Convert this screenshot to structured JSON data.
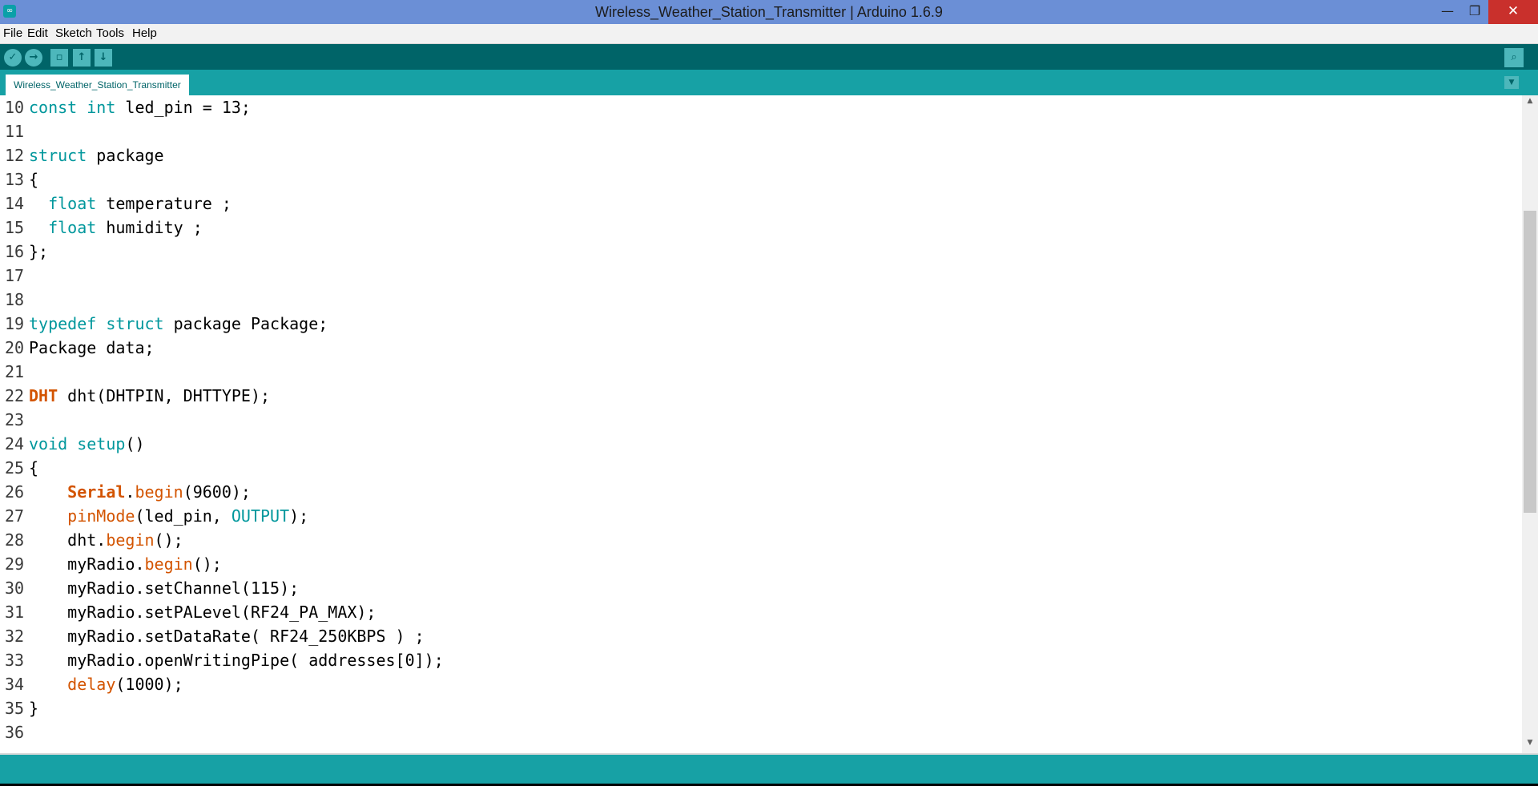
{
  "window": {
    "title": "Wireless_Weather_Station_Transmitter | Arduino 1.6.9",
    "app_icon": "∞",
    "minimize": "—",
    "maximize": "❐",
    "close": "✕"
  },
  "menubar": {
    "items": [
      "File",
      "Edit",
      "Sketch",
      "Tools",
      "Help"
    ]
  },
  "toolbar": {
    "verify_icon": "✓",
    "upload_icon": "→",
    "new_icon": "▫",
    "open_icon": "↑",
    "save_icon": "↓",
    "serial_monitor_icon": "⌕"
  },
  "tabs": {
    "active": "Wireless_Weather_Station_Transmitter",
    "menu_icon": "▼"
  },
  "editor": {
    "lines": [
      {
        "n": "10",
        "tokens": [
          {
            "c": "kw",
            "t": "const"
          },
          {
            "c": "txt",
            "t": " "
          },
          {
            "c": "kw",
            "t": "int"
          },
          {
            "c": "txt",
            "t": " led_pin = 13;"
          }
        ]
      },
      {
        "n": "11",
        "tokens": []
      },
      {
        "n": "12",
        "tokens": [
          {
            "c": "kw",
            "t": "struct"
          },
          {
            "c": "txt",
            "t": " package"
          }
        ]
      },
      {
        "n": "13",
        "tokens": [
          {
            "c": "txt",
            "t": "{"
          }
        ]
      },
      {
        "n": "14",
        "tokens": [
          {
            "c": "txt",
            "t": "  "
          },
          {
            "c": "kw",
            "t": "float"
          },
          {
            "c": "txt",
            "t": " temperature ;"
          }
        ]
      },
      {
        "n": "15",
        "tokens": [
          {
            "c": "txt",
            "t": "  "
          },
          {
            "c": "kw",
            "t": "float"
          },
          {
            "c": "txt",
            "t": " humidity ;"
          }
        ]
      },
      {
        "n": "16",
        "tokens": [
          {
            "c": "txt",
            "t": "};"
          }
        ]
      },
      {
        "n": "17",
        "tokens": []
      },
      {
        "n": "18",
        "tokens": []
      },
      {
        "n": "19",
        "tokens": [
          {
            "c": "kw",
            "t": "typedef"
          },
          {
            "c": "txt",
            "t": " "
          },
          {
            "c": "kw",
            "t": "struct"
          },
          {
            "c": "txt",
            "t": " package Package;"
          }
        ]
      },
      {
        "n": "20",
        "tokens": [
          {
            "c": "txt",
            "t": "Package data;"
          }
        ]
      },
      {
        "n": "21",
        "tokens": []
      },
      {
        "n": "22",
        "tokens": [
          {
            "c": "cls",
            "t": "DHT"
          },
          {
            "c": "txt",
            "t": " dht(DHTPIN, DHTTYPE);"
          }
        ]
      },
      {
        "n": "23",
        "tokens": []
      },
      {
        "n": "24",
        "tokens": [
          {
            "c": "kw",
            "t": "void"
          },
          {
            "c": "txt",
            "t": " "
          },
          {
            "c": "kw",
            "t": "setup"
          },
          {
            "c": "txt",
            "t": "()"
          }
        ]
      },
      {
        "n": "25",
        "tokens": [
          {
            "c": "txt",
            "t": "{"
          }
        ]
      },
      {
        "n": "26",
        "tokens": [
          {
            "c": "txt",
            "t": "    "
          },
          {
            "c": "cls",
            "t": "Serial"
          },
          {
            "c": "txt",
            "t": "."
          },
          {
            "c": "fn",
            "t": "begin"
          },
          {
            "c": "txt",
            "t": "(9600);"
          }
        ]
      },
      {
        "n": "27",
        "tokens": [
          {
            "c": "txt",
            "t": "    "
          },
          {
            "c": "fn",
            "t": "pinMode"
          },
          {
            "c": "txt",
            "t": "(led_pin, "
          },
          {
            "c": "kw",
            "t": "OUTPUT"
          },
          {
            "c": "txt",
            "t": ");"
          }
        ]
      },
      {
        "n": "28",
        "tokens": [
          {
            "c": "txt",
            "t": "    dht."
          },
          {
            "c": "fn",
            "t": "begin"
          },
          {
            "c": "txt",
            "t": "();"
          }
        ]
      },
      {
        "n": "29",
        "tokens": [
          {
            "c": "txt",
            "t": "    myRadio."
          },
          {
            "c": "fn",
            "t": "begin"
          },
          {
            "c": "txt",
            "t": "();"
          }
        ]
      },
      {
        "n": "30",
        "tokens": [
          {
            "c": "txt",
            "t": "    myRadio.setChannel(115);"
          }
        ]
      },
      {
        "n": "31",
        "tokens": [
          {
            "c": "txt",
            "t": "    myRadio.setPALevel(RF24_PA_MAX);"
          }
        ]
      },
      {
        "n": "32",
        "tokens": [
          {
            "c": "txt",
            "t": "    myRadio.setDataRate( RF24_250KBPS ) ;"
          }
        ]
      },
      {
        "n": "33",
        "tokens": [
          {
            "c": "txt",
            "t": "    myRadio.openWritingPipe( addresses[0]);"
          }
        ]
      },
      {
        "n": "34",
        "tokens": [
          {
            "c": "txt",
            "t": "    "
          },
          {
            "c": "fn",
            "t": "delay"
          },
          {
            "c": "txt",
            "t": "(1000);"
          }
        ]
      },
      {
        "n": "35",
        "tokens": [
          {
            "c": "txt",
            "t": "}"
          }
        ]
      },
      {
        "n": "36",
        "tokens": []
      }
    ]
  },
  "scrollbar": {
    "up_icon": "▲",
    "down_icon": "▼"
  },
  "colors": {
    "keyword": "#00979c",
    "function": "#d35400",
    "toolbar": "#006468",
    "tabbar": "#17a1a5"
  }
}
